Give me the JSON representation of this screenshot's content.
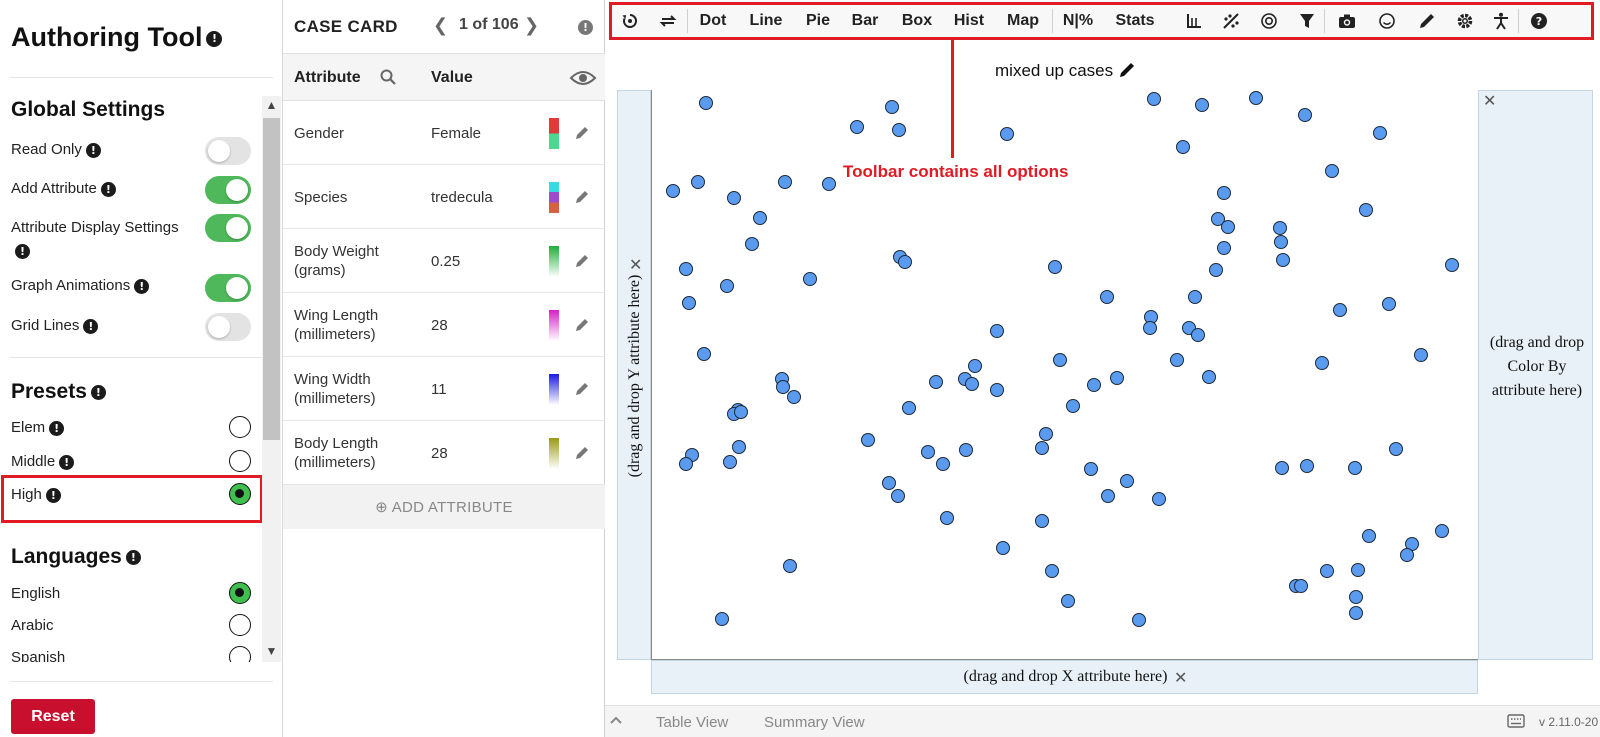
{
  "authoring": {
    "title": "Authoring Tool",
    "global_settings": {
      "title": "Global Settings",
      "items": [
        {
          "label": "Read Only",
          "on": false
        },
        {
          "label": "Add Attribute",
          "on": true
        },
        {
          "label": "Attribute Display Settings",
          "on": true
        },
        {
          "label": "Graph Animations",
          "on": true
        },
        {
          "label": "Grid Lines",
          "on": false
        }
      ]
    },
    "presets": {
      "title": "Presets",
      "items": [
        {
          "label": "Elem",
          "selected": false
        },
        {
          "label": "Middle",
          "selected": false
        },
        {
          "label": "High",
          "selected": true
        }
      ]
    },
    "languages": {
      "title": "Languages",
      "items": [
        {
          "label": "English",
          "selected": true
        },
        {
          "label": "Arabic",
          "selected": false
        },
        {
          "label": "Spanish",
          "selected": false
        }
      ]
    },
    "reset_label": "Reset"
  },
  "case_card": {
    "title": "CASE CARD",
    "count": "1 of 106",
    "attribute_header": "Attribute",
    "value_header": "Value",
    "rows": [
      {
        "attribute": "Gender",
        "value": "Female"
      },
      {
        "attribute": "Species",
        "value": "tredecula"
      },
      {
        "attribute": "Body Weight (grams)",
        "value": "0.25"
      },
      {
        "attribute": "Wing Length (millimeters)",
        "value": "28"
      },
      {
        "attribute": "Wing Width (millimeters)",
        "value": "11"
      },
      {
        "attribute": "Body Length (millimeters)",
        "value": "28"
      }
    ],
    "add_attribute_label": "ADD ATTRIBUTE"
  },
  "toolbar": {
    "items": [
      "Dot",
      "Line",
      "Pie",
      "Bar",
      "Box",
      "Hist",
      "Map",
      "N|%",
      "Stats"
    ],
    "icons": [
      "reset-view-icon",
      "swap-icon",
      "axis-icon",
      "trend-icon",
      "target-icon",
      "filter-icon",
      "camera-icon",
      "face-icon",
      "pencil-icon",
      "gear-icon",
      "accessibility-icon",
      "help-icon"
    ]
  },
  "annotation": {
    "callout": "Toolbar contains all options"
  },
  "graph": {
    "title": "mixed up cases",
    "y_drop": "(drag and drop Y attribute here)",
    "x_drop": "(drag and drop X attribute here)",
    "color_drop": "(drag and drop Color By attribute here)",
    "point_color": "#5b9bef"
  },
  "footer": {
    "tabs": [
      "Table View",
      "Summary View"
    ],
    "version": "v 2.11.0-20"
  }
}
